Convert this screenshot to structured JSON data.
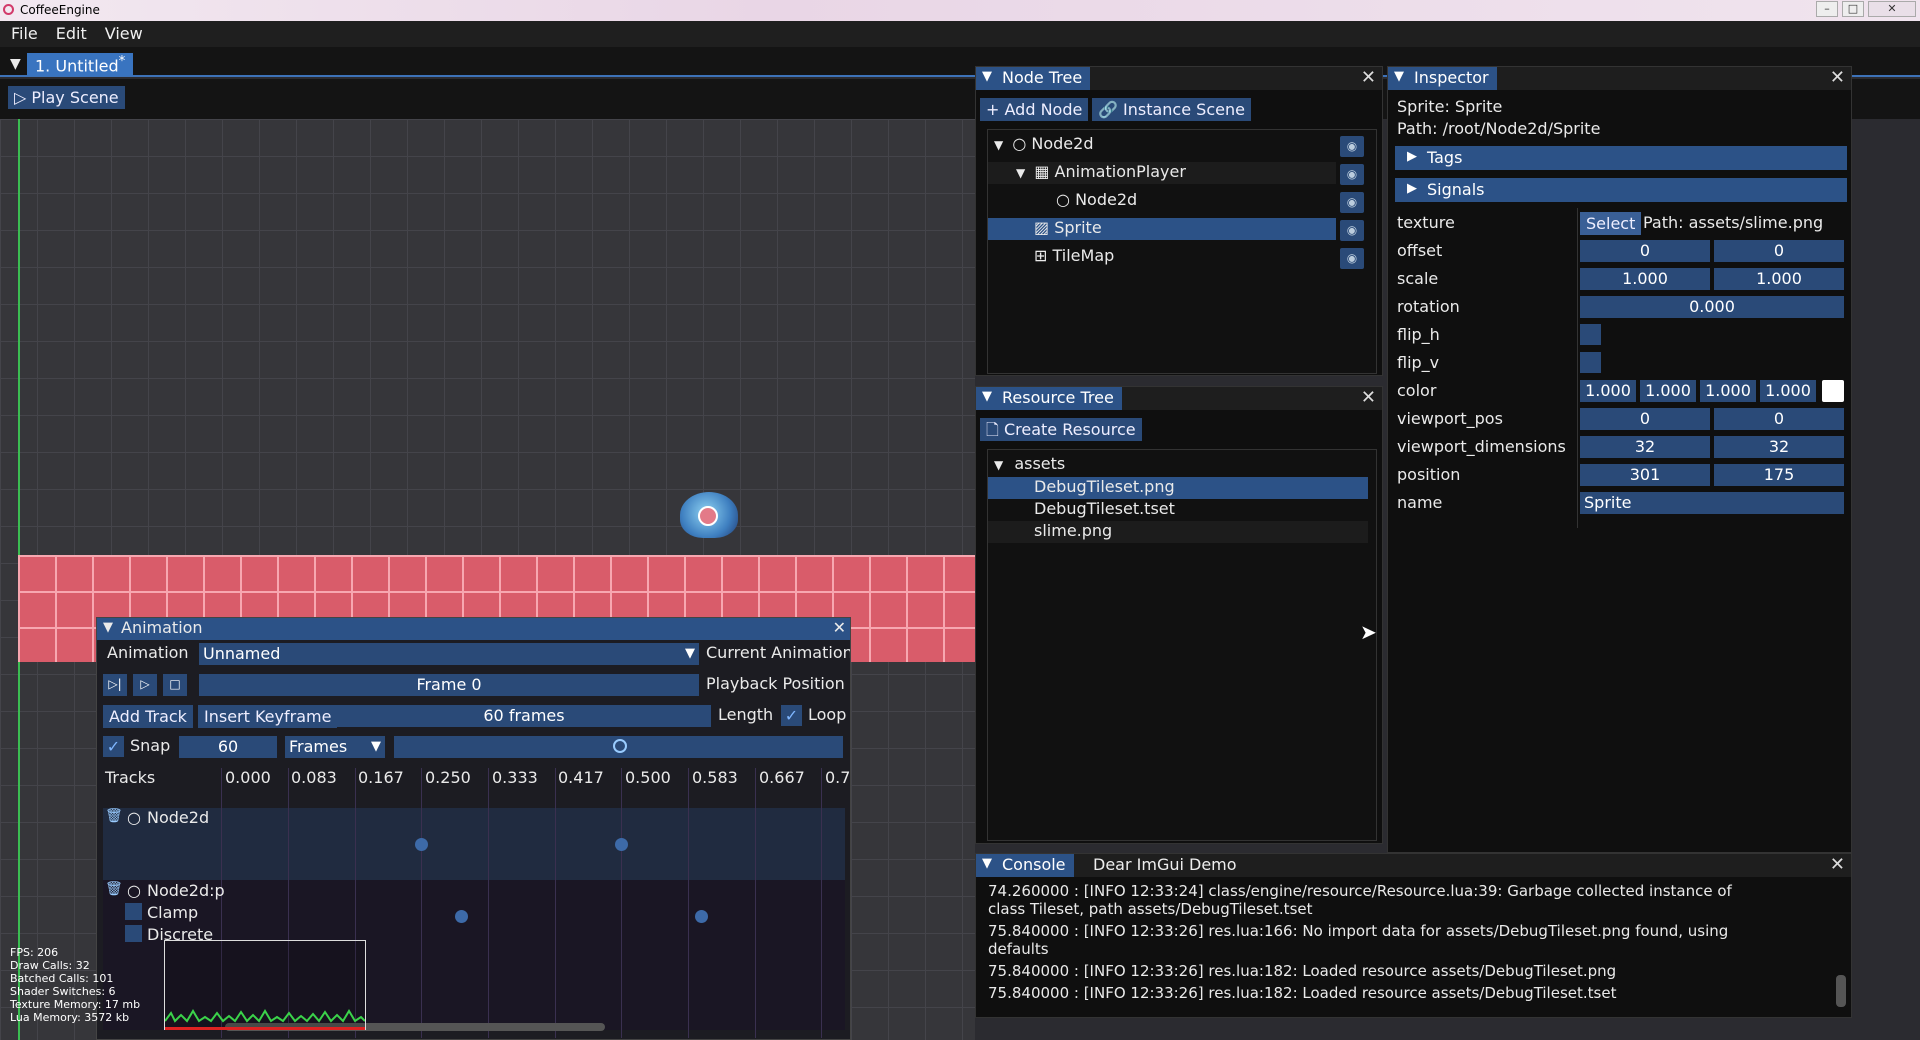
{
  "window": {
    "title": "CoffeeEngine"
  },
  "menu": {
    "file": "File",
    "edit": "Edit",
    "view": "View"
  },
  "scene_tab": {
    "label": "1. Untitled",
    "modified_mark": "*"
  },
  "toolbar": {
    "play_scene": "Play Scene"
  },
  "node_tree": {
    "title": "Node Tree",
    "add_node": "Add Node",
    "instance_scene": "Instance Scene",
    "nodes": [
      "Node2d",
      "AnimationPlayer",
      "Node2d",
      "Sprite",
      "TileMap"
    ]
  },
  "resource_tree": {
    "title": "Resource Tree",
    "create_resource": "Create Resource",
    "folder": "assets",
    "files": [
      "DebugTileset.png",
      "DebugTileset.tset",
      "slime.png"
    ]
  },
  "inspector": {
    "title": "Inspector",
    "node_line": "Sprite: Sprite",
    "path_line": "Path: /root/Node2d/Sprite",
    "tags": "Tags",
    "signals": "Signals",
    "texture_label": "texture",
    "texture_select": "Select",
    "texture_path": "Path:  assets/slime.png",
    "offset_label": "offset",
    "offset": [
      "0",
      "0"
    ],
    "scale_label": "scale",
    "scale": [
      "1.000",
      "1.000"
    ],
    "rotation_label": "rotation",
    "rotation": "0.000",
    "flip_h_label": "flip_h",
    "flip_v_label": "flip_v",
    "color_label": "color",
    "color": [
      "1.000",
      "1.000",
      "1.000",
      "1.000"
    ],
    "viewport_pos_label": "viewport_pos",
    "viewport_pos": [
      "0",
      "0"
    ],
    "viewport_dimensions_label": "viewport_dimensions",
    "viewport_dimensions": [
      "32",
      "32"
    ],
    "position_label": "position",
    "position": [
      "301",
      "175"
    ],
    "name_label": "name",
    "name": "Sprite"
  },
  "console": {
    "tab_console": "Console",
    "tab_demo": "Dear ImGui Demo",
    "lines": [
      "74.260000 : [INFO  12:33:24] class/engine/resource/Resource.lua:39: Garbage collected instance of class Tileset, path assets/DebugTileset.tset",
      "75.840000 : [INFO  12:33:26] res.lua:166: No import data for assets/DebugTileset.png found, using defaults",
      "75.840000 : [INFO  12:33:26] res.lua:182: Loaded resource assets/DebugTileset.png",
      "75.840000 : [INFO  12:33:26] res.lua:182: Loaded resource assets/DebugTileset.tset"
    ]
  },
  "animation": {
    "title": "Animation",
    "animation_label": "Animation",
    "animation_value": "Unnamed",
    "current_animation": "Current Animation",
    "frame": "Frame 0",
    "playback_position": "Playback Position",
    "add_track": "Add Track",
    "insert_keyframe": "Insert Keyframe",
    "length_value": "60 frames",
    "length_label": "Length",
    "loop_label": "Loop",
    "snap_label": "Snap",
    "snap_value": "60",
    "unit": "Frames",
    "tracks_label": "Tracks",
    "ticks": [
      "0.000",
      "0.083",
      "0.167",
      "0.250",
      "0.333",
      "0.417",
      "0.500",
      "0.583",
      "0.667",
      "0.7"
    ],
    "track1": "Node2d",
    "track2": "Node2d:p",
    "clamp": "Clamp",
    "discrete": "Discrete"
  },
  "stats": {
    "fps": "FPS: 206",
    "draw_calls": "Draw Calls: 32",
    "batched_calls": "Batched Calls: 101",
    "shader_switches": "Shader Switches: 6",
    "texture_memory": "Texture Memory: 17 mb",
    "lua_memory": "Lua Memory: 3572 kb"
  }
}
